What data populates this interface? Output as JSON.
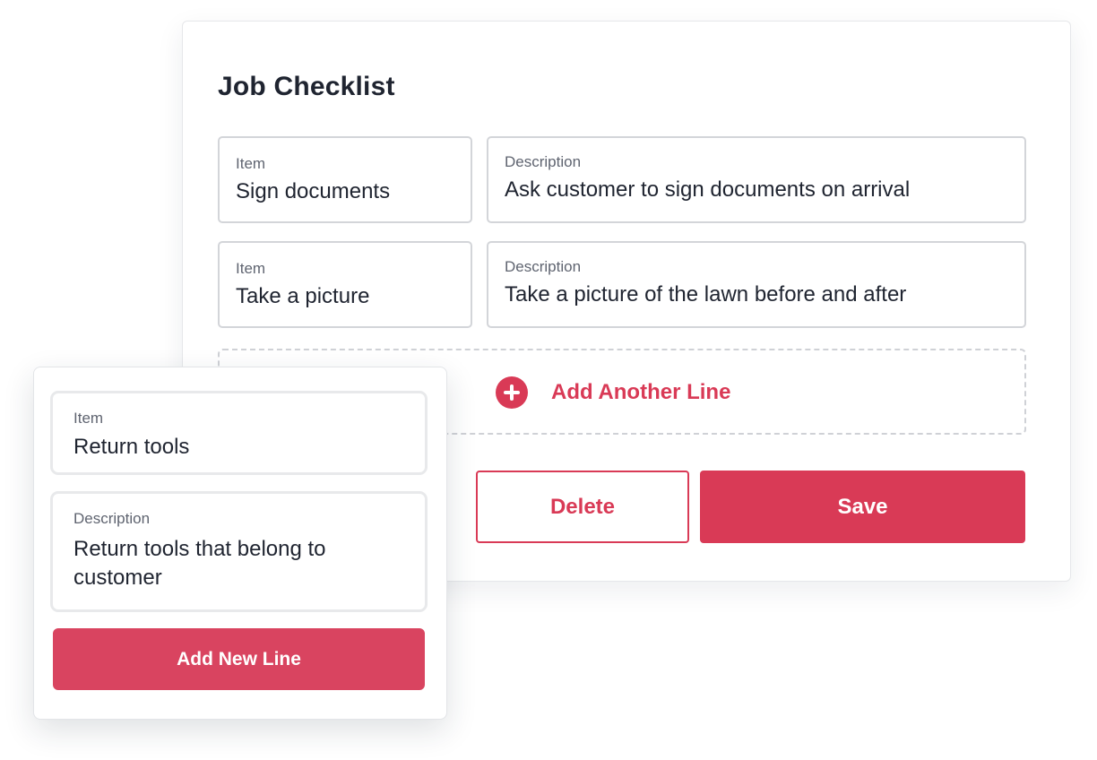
{
  "checklist": {
    "title": "Job Checklist",
    "rows": [
      {
        "item_label": "Item",
        "item_value": "Sign documents",
        "description_label": "Description",
        "description_value": "Ask customer to sign documents on arrival"
      },
      {
        "item_label": "Item",
        "item_value": "Take a picture",
        "description_label": "Description",
        "description_value": "Take a picture of the lawn before and after"
      }
    ],
    "add_another_label": "Add Another Line",
    "add_another_icon": "plus-circle-icon",
    "delete_label": "Delete",
    "save_label": "Save"
  },
  "new_line_card": {
    "item_label": "Item",
    "item_value": "Return tools",
    "description_label": "Description",
    "description_value": "Return tools that belong to customer",
    "add_new_label": "Add New Line"
  },
  "colors": {
    "accent": "#d93a56",
    "text": "#1f2430",
    "label": "#5f6470",
    "border": "#d3d5d9"
  }
}
